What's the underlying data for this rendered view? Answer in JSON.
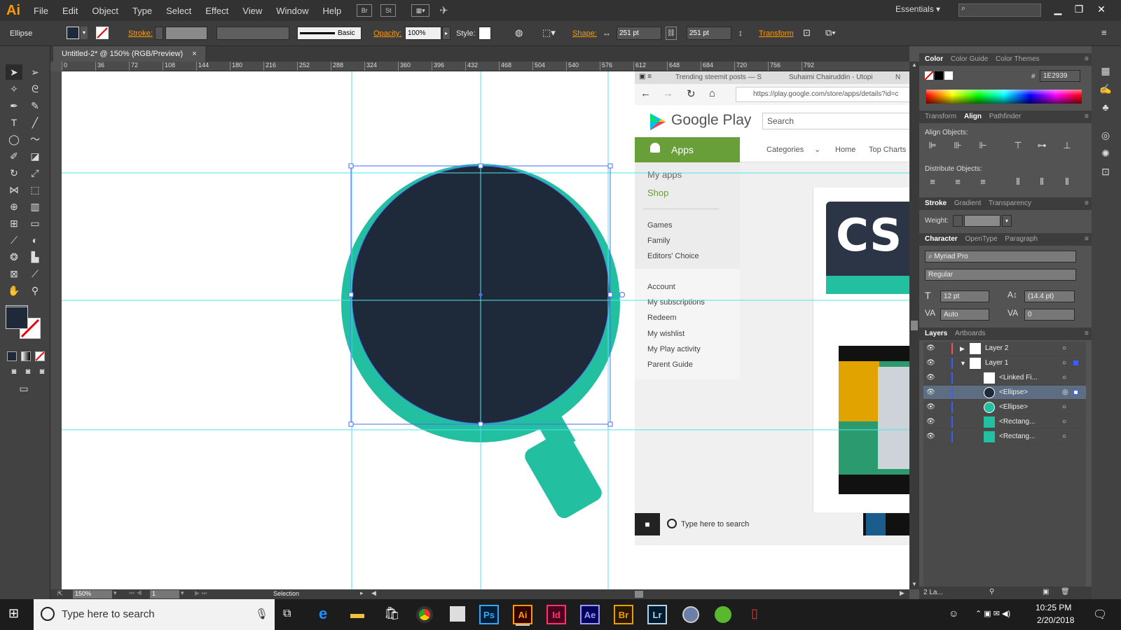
{
  "app": {
    "logo": "Ai",
    "accent": "#ff9a00"
  },
  "menu": [
    "File",
    "Edit",
    "Object",
    "Type",
    "Select",
    "Effect",
    "View",
    "Window",
    "Help"
  ],
  "menu_buttons": [
    "Br",
    "St"
  ],
  "workspace": "Essentials",
  "control": {
    "selection_label": "Ellipse",
    "stroke_label": "Stroke:",
    "brush_label": "Basic",
    "opacity_label": "Opacity:",
    "opacity_value": "100%",
    "style_label": "Style:",
    "shape_label": "Shape:",
    "width_value": "251 pt",
    "height_value": "251 pt",
    "transform_label": "Transform"
  },
  "document": {
    "tab_title": "Untitled-2* @ 150% (RGB/Preview)",
    "close": "×"
  },
  "ruler_h": [
    "0",
    "36",
    "72",
    "108",
    "144",
    "180",
    "216",
    "252",
    "288",
    "324",
    "360",
    "396",
    "432",
    "468",
    "504",
    "540",
    "576",
    "612",
    "648",
    "684",
    "720",
    "756",
    "792"
  ],
  "artwork": {
    "teal": "#22bfa0",
    "navy": "#1e2939",
    "guide": "#4ee6ea",
    "selection": "#4a6cf7"
  },
  "linked_image": {
    "tabs": [
      "Trending steemit posts — S",
      "Suhaimi Chairuddin - Utopi",
      "N"
    ],
    "url": "https://play.google.com/store/apps/details?id=c",
    "logo_text": "Google Play",
    "search_placeholder": "Search",
    "apps_label": "Apps",
    "nav": [
      "Categories",
      "Home",
      "Top Charts"
    ],
    "side_top": [
      "My apps",
      "Shop"
    ],
    "side_cats": [
      "Games",
      "Family",
      "Editors' Choice"
    ],
    "side_account": [
      "Account",
      "My subscriptions",
      "Redeem",
      "My wishlist",
      "My Play activity",
      "Parent Guide"
    ],
    "cs_text": "CS",
    "taskbar_search": "Type here to search"
  },
  "status": {
    "zoom": "150%",
    "artboard": "1",
    "tool": "Selection"
  },
  "panels": {
    "color_tabs": [
      "Color",
      "Color Guide",
      "Color Themes"
    ],
    "hex_label": "#",
    "hex_value": "1E2939",
    "align_tabs": [
      "Transform",
      "Align",
      "Pathfinder"
    ],
    "align_objects": "Align Objects:",
    "distribute_objects": "Distribute Objects:",
    "stroke_tabs": [
      "Stroke",
      "Gradient",
      "Transparency"
    ],
    "weight_label": "Weight:",
    "char_tabs": [
      "Character",
      "OpenType",
      "Paragraph"
    ],
    "font": "Myriad Pro",
    "font_style": "Regular",
    "font_size": "12 pt",
    "leading": "(14.4 pt)",
    "kerning": "Auto",
    "tracking": "0",
    "layer_tabs": [
      "Layers",
      "Artboards"
    ],
    "layers": [
      {
        "name": "Layer 2"
      },
      {
        "name": "Layer 1"
      },
      {
        "name": "<Linked Fi..."
      },
      {
        "name": "<Ellipse>"
      },
      {
        "name": "<Ellipse>"
      },
      {
        "name": "<Rectang..."
      },
      {
        "name": "<Rectang..."
      }
    ],
    "layers_count": "2 La..."
  },
  "taskbar": {
    "search": "Type here to search",
    "apps": [
      "Ps",
      "Ai",
      "Id",
      "Ae",
      "Br",
      "Lr"
    ],
    "time": "10:25 PM",
    "date": "2/20/2018"
  }
}
